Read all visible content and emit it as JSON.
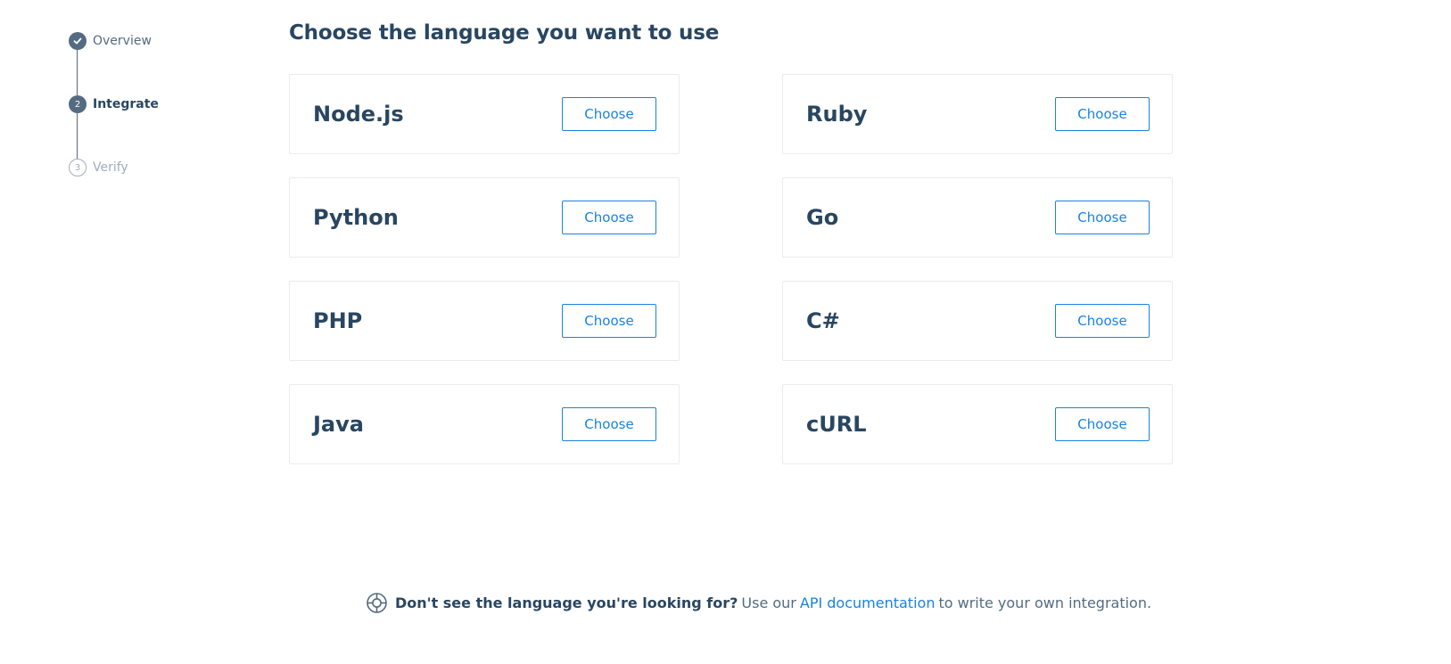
{
  "stepper": {
    "steps": [
      {
        "number": "",
        "label": "Overview",
        "state": "done"
      },
      {
        "number": "2",
        "label": "Integrate",
        "state": "active"
      },
      {
        "number": "3",
        "label": "Verify",
        "state": "pending"
      }
    ]
  },
  "main": {
    "title": "Choose the language you want to use",
    "languages": [
      {
        "name": "Node.js",
        "button": "Choose"
      },
      {
        "name": "Ruby",
        "button": "Choose"
      },
      {
        "name": "Python",
        "button": "Choose"
      },
      {
        "name": "Go",
        "button": "Choose"
      },
      {
        "name": "PHP",
        "button": "Choose"
      },
      {
        "name": "C#",
        "button": "Choose"
      },
      {
        "name": "Java",
        "button": "Choose"
      },
      {
        "name": "cURL",
        "button": "Choose"
      }
    ]
  },
  "footer": {
    "icon": "lifebuoy-icon",
    "question": "Don't see the language you're looking for?",
    "pre_link": "Use our",
    "link": "API documentation",
    "post_link": "to write your own integration."
  },
  "colors": {
    "primary_text": "#294661",
    "muted_text": "#546b81",
    "accent": "#1a82e2",
    "card_border": "#e9ecef"
  }
}
